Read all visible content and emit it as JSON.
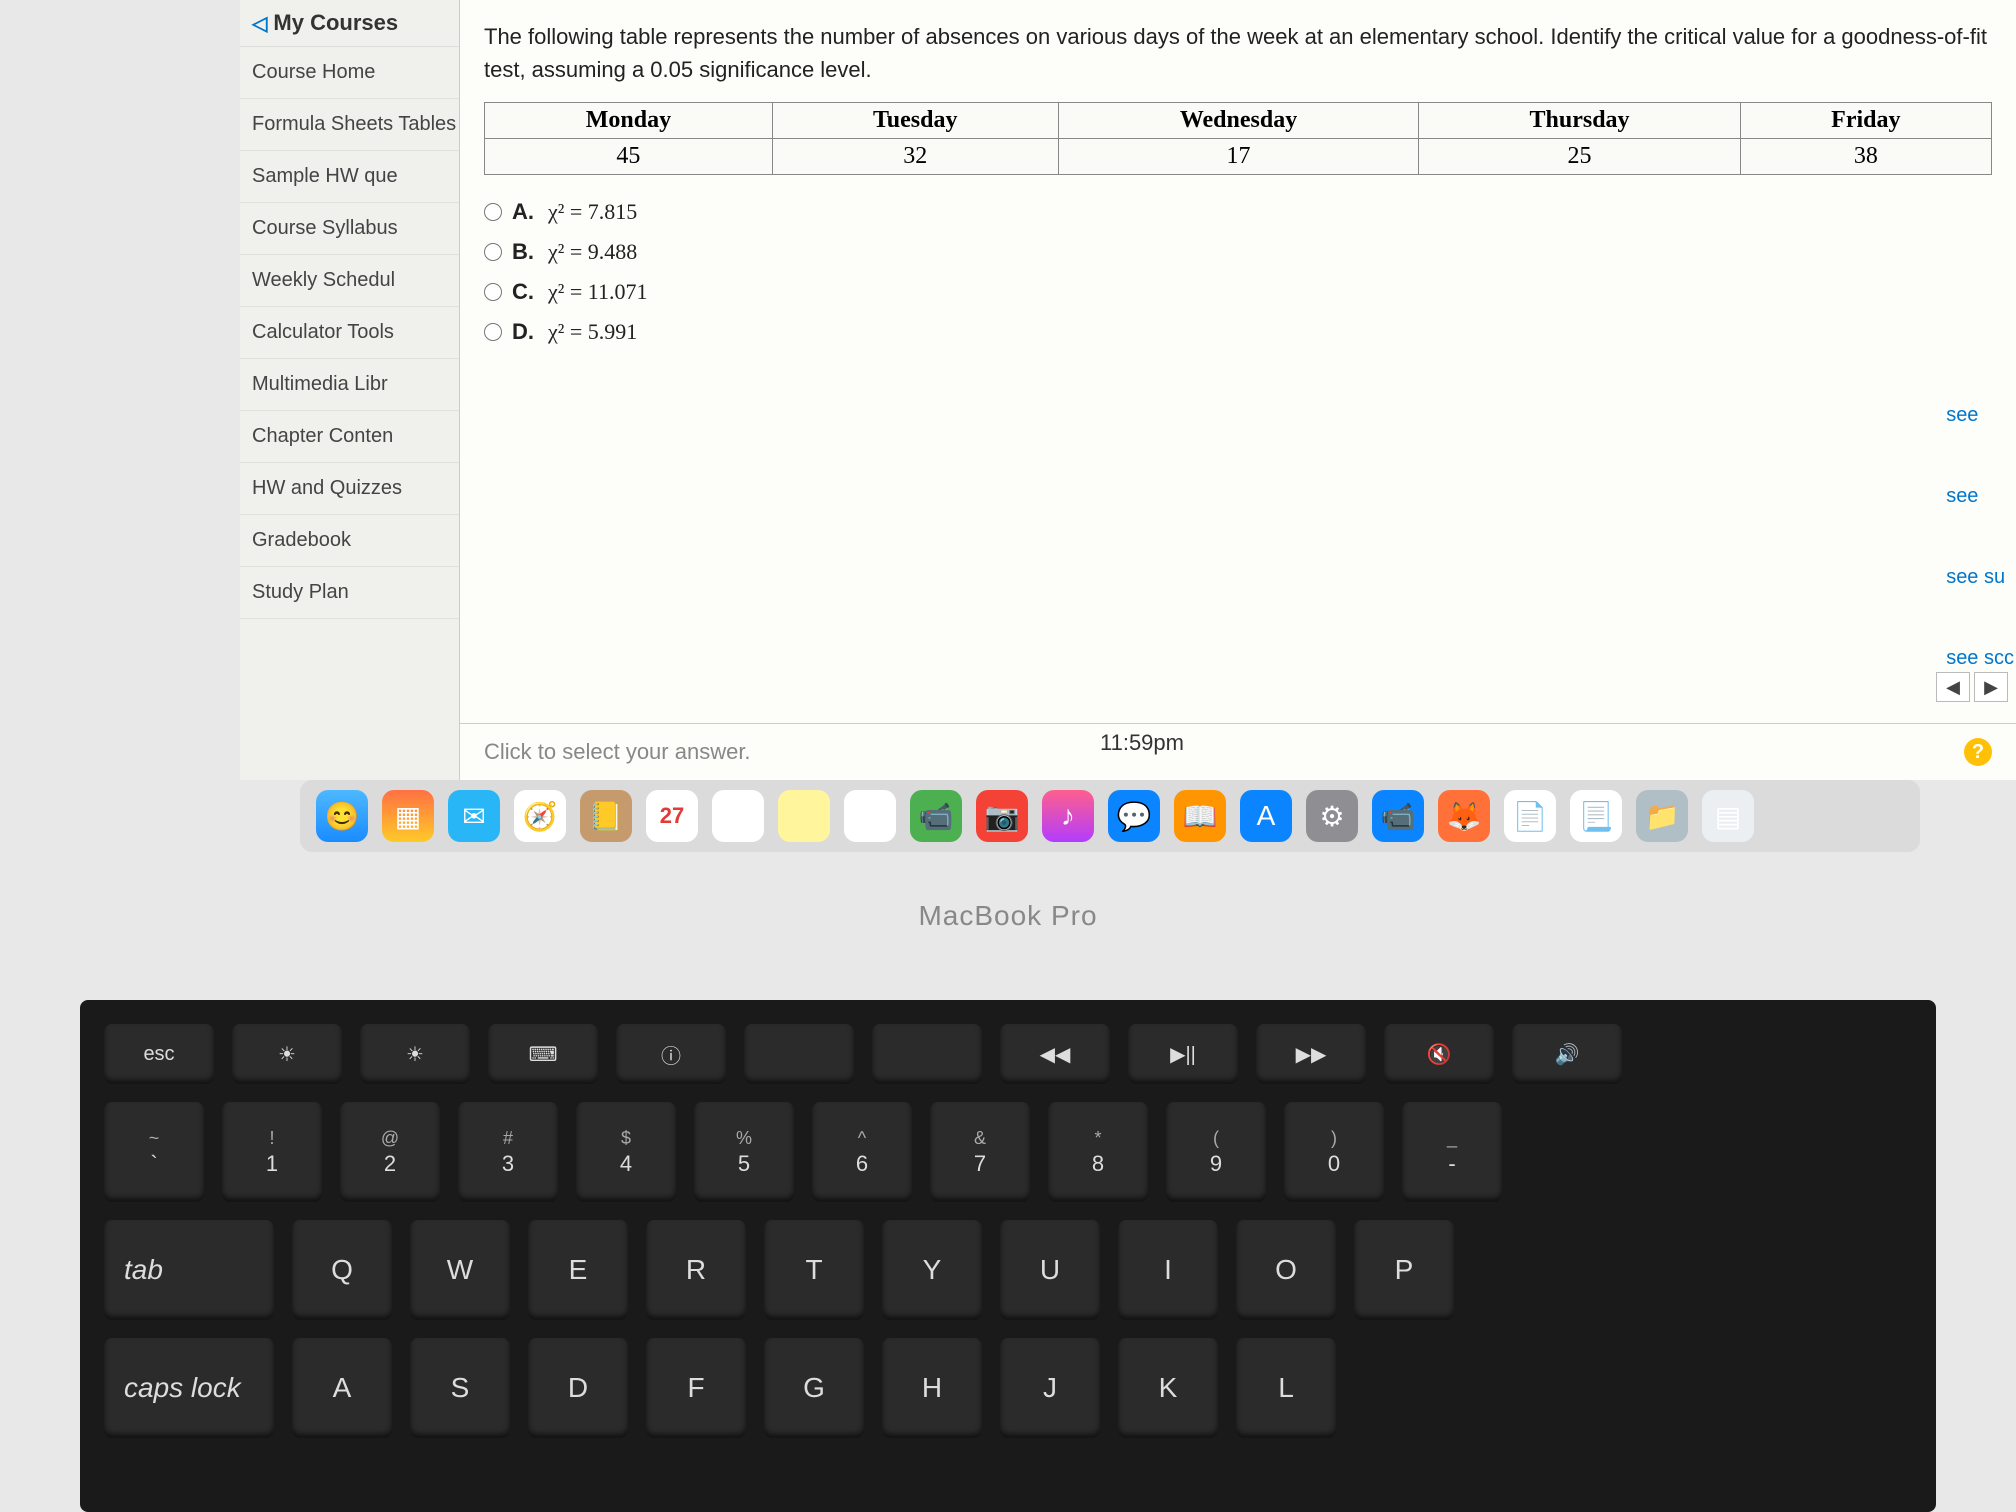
{
  "sidebar": {
    "header": "My Courses",
    "items": [
      "Course Home",
      "Formula Sheets Tables",
      "Sample HW que",
      "Course Syllabus",
      "Weekly Schedul",
      "Calculator Tools",
      "Multimedia Libr",
      "Chapter Conten",
      "HW and Quizzes",
      "Gradebook",
      "Study Plan"
    ]
  },
  "question": {
    "prompt": "The following table represents the number of absences on various days of the week at an elementary school. Identify the critical value for a goodness-of-fit test, assuming a 0.05 significance level."
  },
  "chart_data": {
    "type": "table",
    "headers": [
      "Monday",
      "Tuesday",
      "Wednesday",
      "Thursday",
      "Friday"
    ],
    "rows": [
      [
        45,
        32,
        17,
        25,
        38
      ]
    ]
  },
  "options": [
    {
      "letter": "A.",
      "expr": "χ² = 7.815"
    },
    {
      "letter": "B.",
      "expr": "χ² = 9.488"
    },
    {
      "letter": "C.",
      "expr": "χ² = 11.071"
    },
    {
      "letter": "D.",
      "expr": "χ² = 5.991"
    }
  ],
  "footer": {
    "hint": "Click to select your answer.",
    "help": "?"
  },
  "time": "11:59pm",
  "right_edge": [
    "see",
    "see",
    "see su",
    "see scc"
  ],
  "dock_calendar": "27",
  "laptop": "MacBook Pro",
  "keyboard": {
    "fn_row": [
      "esc",
      "☀",
      "☀",
      "⌨",
      "ⓘ",
      "",
      "",
      "◀◀",
      "▶||",
      "▶▶",
      "🔇",
      "🔊"
    ],
    "num_row": [
      {
        "t": "~",
        "b": "`"
      },
      {
        "t": "!",
        "b": "1"
      },
      {
        "t": "@",
        "b": "2"
      },
      {
        "t": "#",
        "b": "3"
      },
      {
        "t": "$",
        "b": "4"
      },
      {
        "t": "%",
        "b": "5"
      },
      {
        "t": "^",
        "b": "6"
      },
      {
        "t": "&",
        "b": "7"
      },
      {
        "t": "*",
        "b": "8"
      },
      {
        "t": "(",
        "b": "9"
      },
      {
        "t": ")",
        "b": "0"
      },
      {
        "t": "_",
        "b": "-"
      }
    ],
    "qwerty": [
      "tab",
      "Q",
      "W",
      "E",
      "R",
      "T",
      "Y",
      "U",
      "I",
      "O",
      "P"
    ],
    "asdf": [
      "caps lock",
      "A",
      "S",
      "D",
      "F",
      "G",
      "H",
      "J",
      "K",
      "L"
    ]
  }
}
